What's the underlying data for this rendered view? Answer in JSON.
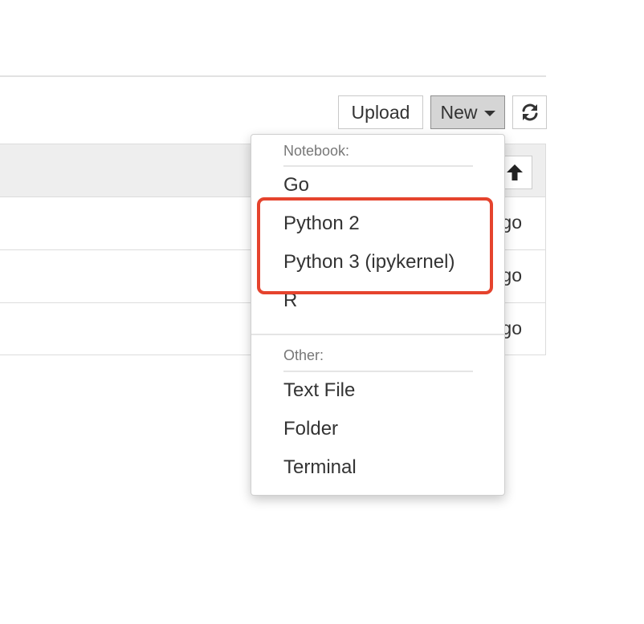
{
  "toolbar": {
    "upload_label": "Upload",
    "new_label": "New",
    "refresh_icon": "refresh-icon"
  },
  "list": {
    "sort_icon": "arrow-up-icon",
    "rows": [
      {
        "modified": "go"
      },
      {
        "modified": "go"
      },
      {
        "modified": "go"
      }
    ]
  },
  "new_menu": {
    "notebook_header": "Notebook:",
    "notebook_items": [
      "Go",
      "Python 2",
      "Python 3 (ipykernel)",
      "R"
    ],
    "other_header": "Other:",
    "other_items": [
      "Text File",
      "Folder",
      "Terminal"
    ]
  },
  "colors": {
    "highlight": "#e5432d",
    "new_button_bg": "#d5d5d5",
    "list_header_bg": "#eeeeee"
  }
}
